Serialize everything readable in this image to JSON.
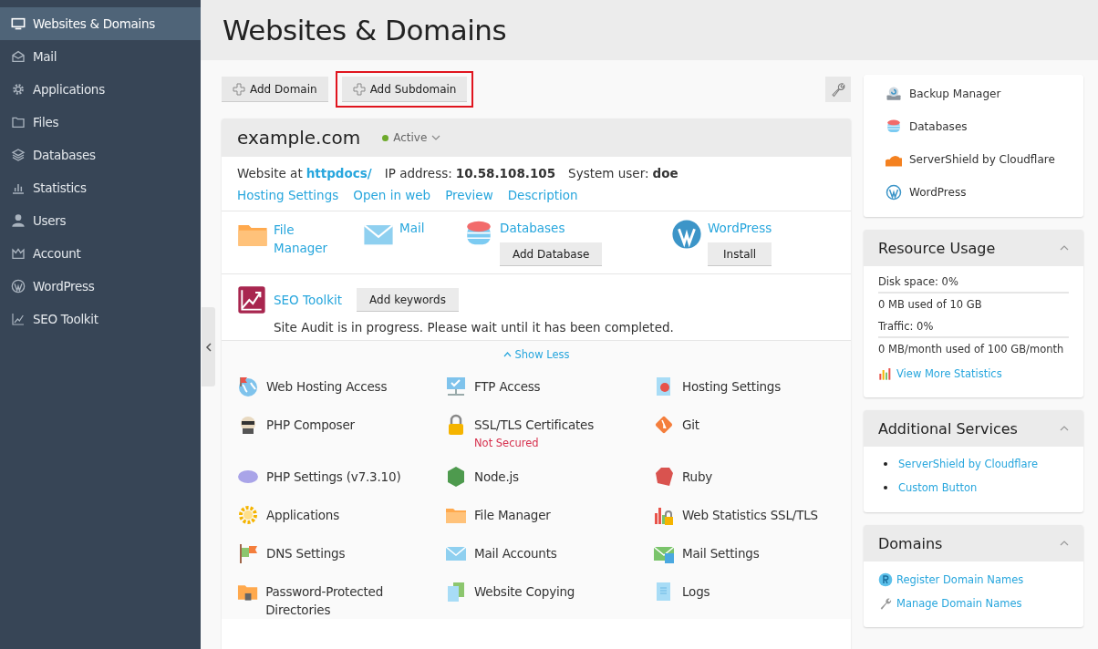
{
  "sidebar": {
    "items": [
      {
        "label": "Websites & Domains",
        "selected": true
      },
      {
        "label": "Mail",
        "selected": false
      },
      {
        "label": "Applications",
        "selected": false
      },
      {
        "label": "Files",
        "selected": false
      },
      {
        "label": "Databases",
        "selected": false
      },
      {
        "label": "Statistics",
        "selected": false
      },
      {
        "label": "Users",
        "selected": false
      },
      {
        "label": "Account",
        "selected": false
      },
      {
        "label": "WordPress",
        "selected": false
      },
      {
        "label": "SEO Toolkit",
        "selected": false
      }
    ]
  },
  "page": {
    "title": "Websites & Domains"
  },
  "toolbar": {
    "buttons": [
      {
        "label": "Add Domain",
        "highlighted": false
      },
      {
        "label": "Add Subdomain",
        "highlighted": true
      }
    ]
  },
  "domain": {
    "name": "example.com",
    "status": "Active",
    "info": [
      {
        "label": "Website at",
        "value": "httpdocs/",
        "kind": "link"
      },
      {
        "label": "IP address:",
        "value": "10.58.108.105",
        "kind": "text"
      },
      {
        "label": "System user:",
        "value": "doe",
        "kind": "text"
      }
    ],
    "links": [
      "Hosting Settings",
      "Open in web",
      "Preview",
      "Description"
    ],
    "quick": [
      {
        "label": "File Manager"
      },
      {
        "label": "Mail"
      },
      {
        "label": "Databases",
        "button": "Add Database"
      },
      {
        "label": "WordPress",
        "button": "Install"
      }
    ],
    "seo": {
      "label": "SEO Toolkit",
      "button": "Add keywords",
      "message": "Site Audit is in progress. Please wait until it has been completed."
    },
    "toggle": "Show Less",
    "tools": [
      {
        "label": "Web Hosting Access"
      },
      {
        "label": "FTP Access"
      },
      {
        "label": "Hosting Settings"
      },
      {
        "label": "PHP Composer"
      },
      {
        "label": "SSL/TLS Certificates",
        "note": "Not Secured"
      },
      {
        "label": "Git"
      },
      {
        "label": "PHP Settings (v7.3.10)"
      },
      {
        "label": "Node.js"
      },
      {
        "label": "Ruby"
      },
      {
        "label": "Applications"
      },
      {
        "label": "File Manager"
      },
      {
        "label": "Web Statistics SSL/TLS"
      },
      {
        "label": "DNS Settings"
      },
      {
        "label": "Mail Accounts"
      },
      {
        "label": "Mail Settings"
      },
      {
        "label": "Password-Protected Directories"
      },
      {
        "label": "Website Copying"
      },
      {
        "label": "Logs"
      }
    ]
  },
  "side": {
    "shortcuts": [
      "Backup Manager",
      "Databases",
      "ServerShield by Cloudflare",
      "WordPress"
    ],
    "resource_usage": {
      "title": "Resource Usage",
      "expanded": true,
      "rows": [
        {
          "label": "Disk space: 0%",
          "detail": "0 MB used of 10 GB"
        },
        {
          "label": "Traffic: 0%",
          "detail": "0 MB/month used of 100 GB/month"
        }
      ],
      "link": "View More Statistics"
    },
    "additional_services": {
      "title": "Additional Services",
      "expanded": true,
      "items": [
        "ServerShield by Cloudflare",
        "Custom Button"
      ]
    },
    "domains": {
      "title": "Domains",
      "expanded": true,
      "items": [
        "Register Domain Names",
        "Manage Domain Names"
      ]
    }
  }
}
